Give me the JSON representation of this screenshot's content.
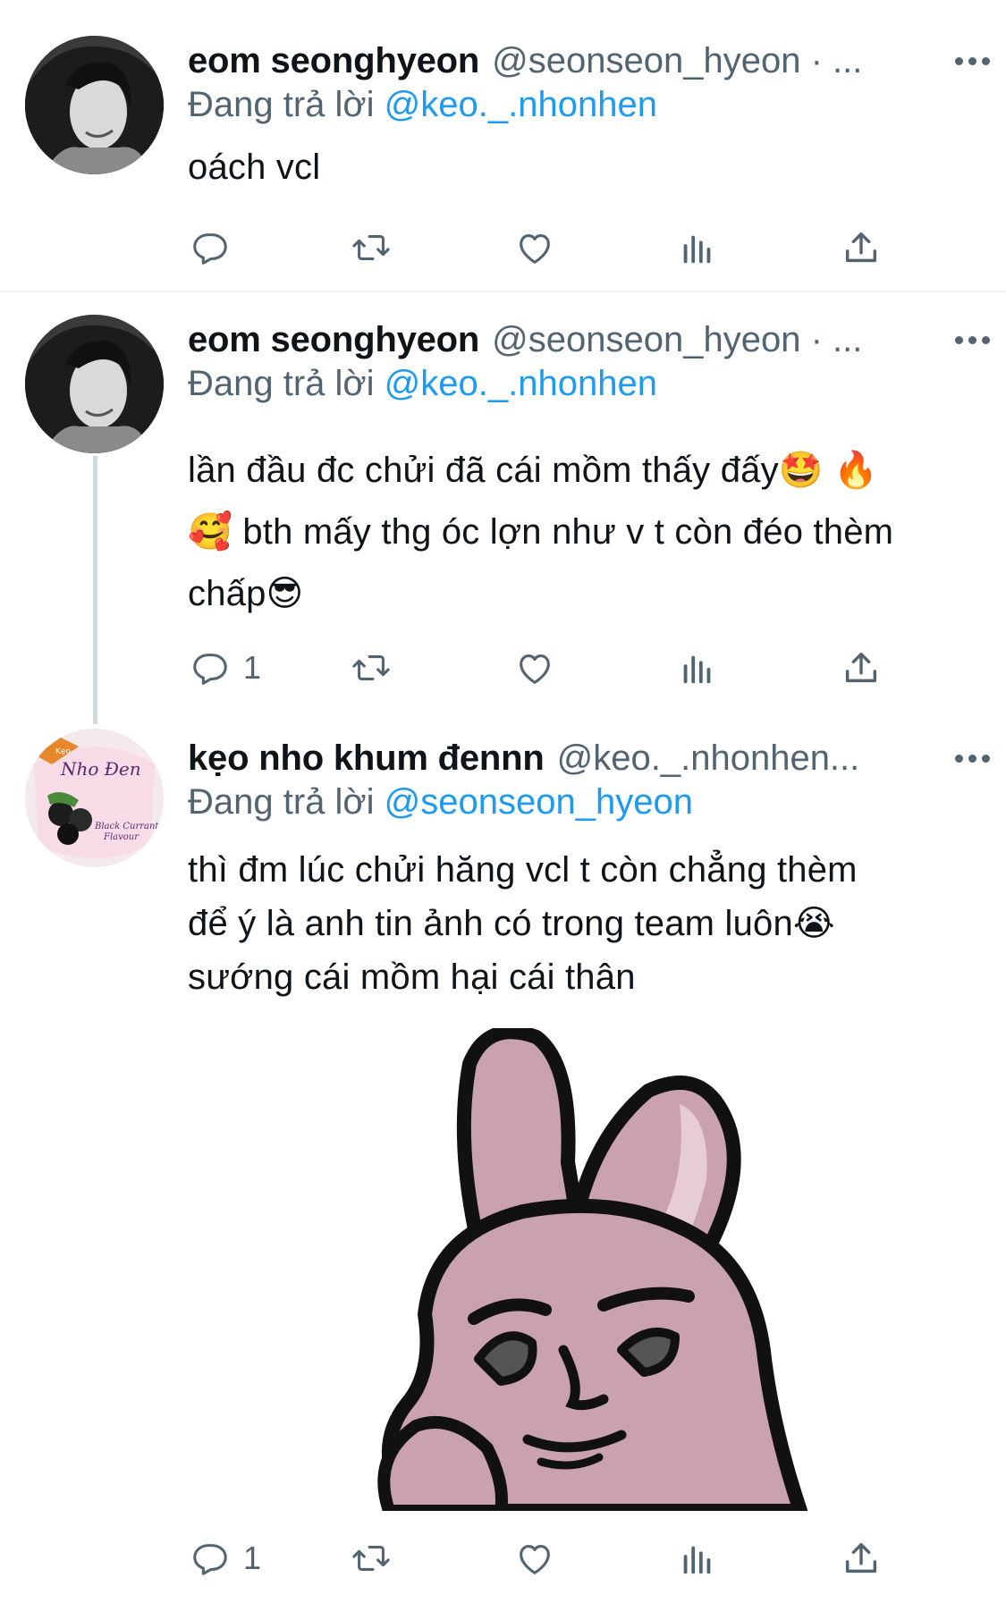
{
  "colors": {
    "link": "#1d9bf0",
    "secondary": "#536471",
    "text": "#0f1419",
    "sticker_pink": "#c9a2ad"
  },
  "tweets": [
    {
      "author_name": "eom seonghyeon",
      "author_handle": "@seonseon_hyeon · ...",
      "reply_prefix": "Đang trả lời",
      "reply_to": "@keo._.nhonhen",
      "lines": [
        "oách vcl"
      ],
      "reply_count": ""
    },
    {
      "author_name": "eom seonghyeon",
      "author_handle": "@seonseon_hyeon · ...",
      "reply_prefix": "Đang trả lời",
      "reply_to": "@keo._.nhonhen",
      "lines": [
        "lần đầu đc chửi đã cái mồm thấy đấy🤩 🔥",
        "🥰  bth mấy thg óc lợn như v t còn đéo thèm",
        "chấp😎"
      ],
      "reply_count": "1"
    },
    {
      "author_name": "kẹo nho khum đennn",
      "author_handle": "@keo._.nhonhen...",
      "reply_prefix": "Đang trả lời",
      "reply_to": "@seonseon_hyeon",
      "lines": [
        "thì đm lúc chửi hăng vcl t còn chẳng thèm",
        "để ý là anh tin ảnh có trong team luôn😭",
        "sướng cái mồm hại cái thân"
      ],
      "reply_count": "1"
    }
  ],
  "avatar_logo_text": {
    "brand": "Nho Đen",
    "flavour": "Black Currant Flavour",
    "small": "Kẹo"
  },
  "icons": [
    "reply-icon",
    "retweet-icon",
    "like-icon",
    "analytics-icon",
    "share-icon",
    "more-icon"
  ]
}
